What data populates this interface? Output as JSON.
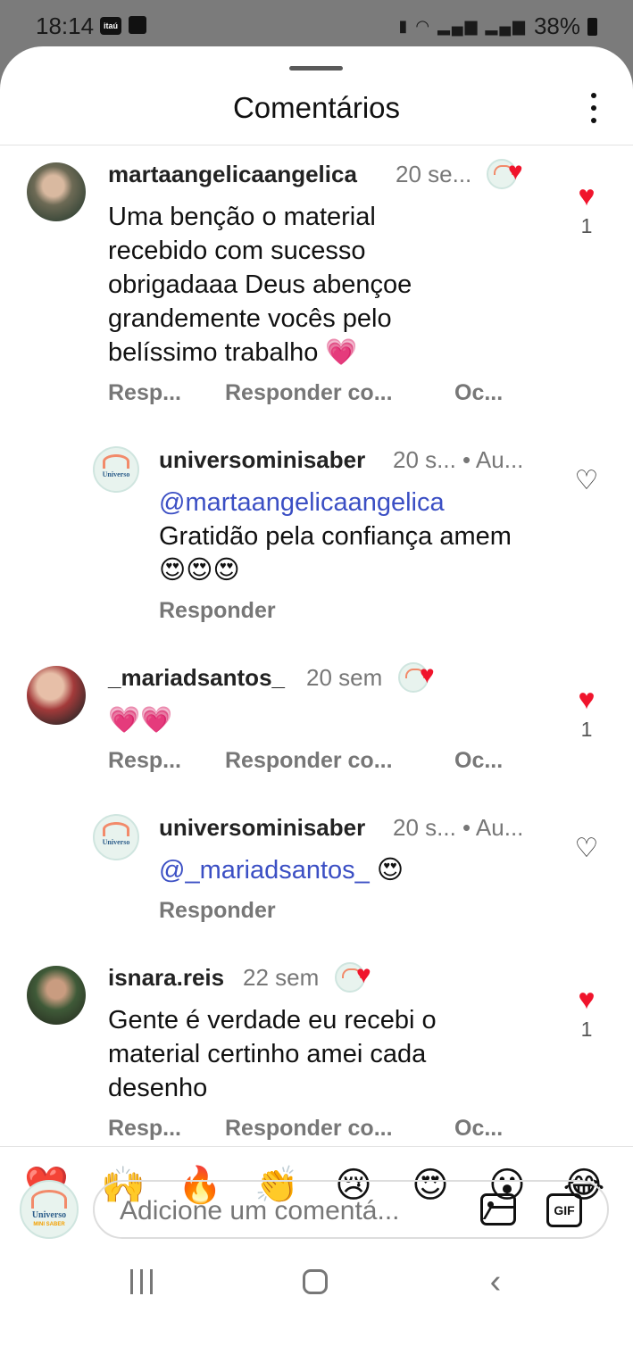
{
  "status_bar": {
    "time": "18:14",
    "carrier_icon": "itaú",
    "battery": "38%"
  },
  "header": {
    "title": "Comentários"
  },
  "comments": [
    {
      "username": "martaangelicaangelica",
      "time": "20 se...",
      "text": "Uma benção o material recebido com sucesso obrigadaaa Deus abençoe grandemente vocês pelo belíssimo trabalho 💗",
      "likes": "1",
      "actions": [
        "Resp...",
        "Responder co...",
        "Oc..."
      ]
    },
    {
      "username": "universominisaber",
      "time": "20 s... • Au...",
      "mention": "@martaangelicaangelica",
      "text": "Gratidão  pela confiança amem😍😍😍",
      "actions": [
        "Responder"
      ]
    },
    {
      "username": "_mariadsantos_",
      "time": "20 sem",
      "text": "💗💗",
      "likes": "1",
      "actions": [
        "Resp...",
        "Responder co...",
        "Oc..."
      ]
    },
    {
      "username": "universominisaber",
      "time": "20 s... • Au...",
      "mention": "@_mariadsantos_",
      "text": " 😍",
      "actions": [
        "Responder"
      ]
    },
    {
      "username": "isnara.reis",
      "time": "22 sem",
      "text": "Gente é verdade eu recebi o material certinho amei cada desenho",
      "likes": "1",
      "actions": [
        "Resp...",
        "Responder co...",
        "Oc..."
      ]
    }
  ],
  "brand_avatar": {
    "word": "Universo",
    "word2": "MINI SABER"
  },
  "emoji_bar": [
    "❤️",
    "🙌",
    "🔥",
    "👏",
    "😢",
    "😍",
    "😮",
    "😂"
  ],
  "composer": {
    "placeholder": "Adicione um comentá...",
    "gif_label": "GIF"
  },
  "icons": {
    "filled_heart": "heart-filled-icon",
    "empty_heart": "heart-outline-icon",
    "more": "more-vertical-icon",
    "image": "image-icon",
    "gif": "gif-icon"
  },
  "colors": {
    "like_red": "#f0142c",
    "mention_blue": "#3b4fc4",
    "muted_text": "#777777"
  }
}
